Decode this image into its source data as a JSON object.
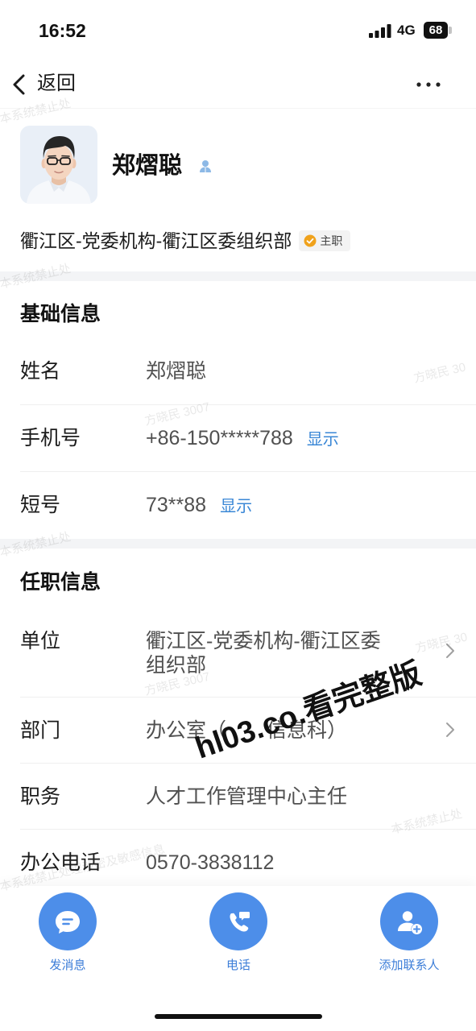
{
  "status_bar": {
    "time": "16:52",
    "network": "4G",
    "battery": "68"
  },
  "nav": {
    "back_label": "返回",
    "back_icon": "chevron-left-icon",
    "more_icon": "more-options-icon"
  },
  "profile": {
    "name": "郑熠聪",
    "org_path": "衢江区-党委机构-衢江区委组织部",
    "badge": "主职"
  },
  "basic_info": {
    "title": "基础信息",
    "rows": [
      {
        "label": "姓名",
        "value": "郑熠聪"
      },
      {
        "label": "手机号",
        "value": "+86-150*****788",
        "action": "显示"
      },
      {
        "label": "短号",
        "value": "73**88",
        "action": "显示"
      }
    ]
  },
  "job_info": {
    "title": "任职信息",
    "rows": [
      {
        "label": "单位",
        "value": "衢江区-党委机构-衢江区委组织部"
      },
      {
        "label": "部门",
        "value_before": "办公室（",
        "value_after": "信息科）"
      },
      {
        "label": "职务",
        "value": "人才工作管理中心主任"
      },
      {
        "label": "办公电话",
        "value": "0570-3838112"
      }
    ]
  },
  "actions": [
    {
      "label": "发消息",
      "icon": "message-icon"
    },
    {
      "label": "电话",
      "icon": "phone-icon"
    },
    {
      "label": "添加联系人",
      "icon": "add-contact-icon"
    }
  ],
  "colors": {
    "accent": "#4d8ee9",
    "link": "#3a87d6",
    "action_label": "#3d7ed8",
    "badge_check": "#f0a21c",
    "person_badge": "#8db9e6"
  },
  "watermarks": {
    "overlay": "hl03.co.看完整版",
    "faint": [
      "本系统禁止处",
      "本系统禁止处",
      "方晓民 30",
      "方晓民 3007",
      "本系统禁止处",
      "方晓民 30",
      "方晓民 3007",
      "本系统禁止处",
      "本系统禁止处理涉密及敏感信息"
    ]
  }
}
